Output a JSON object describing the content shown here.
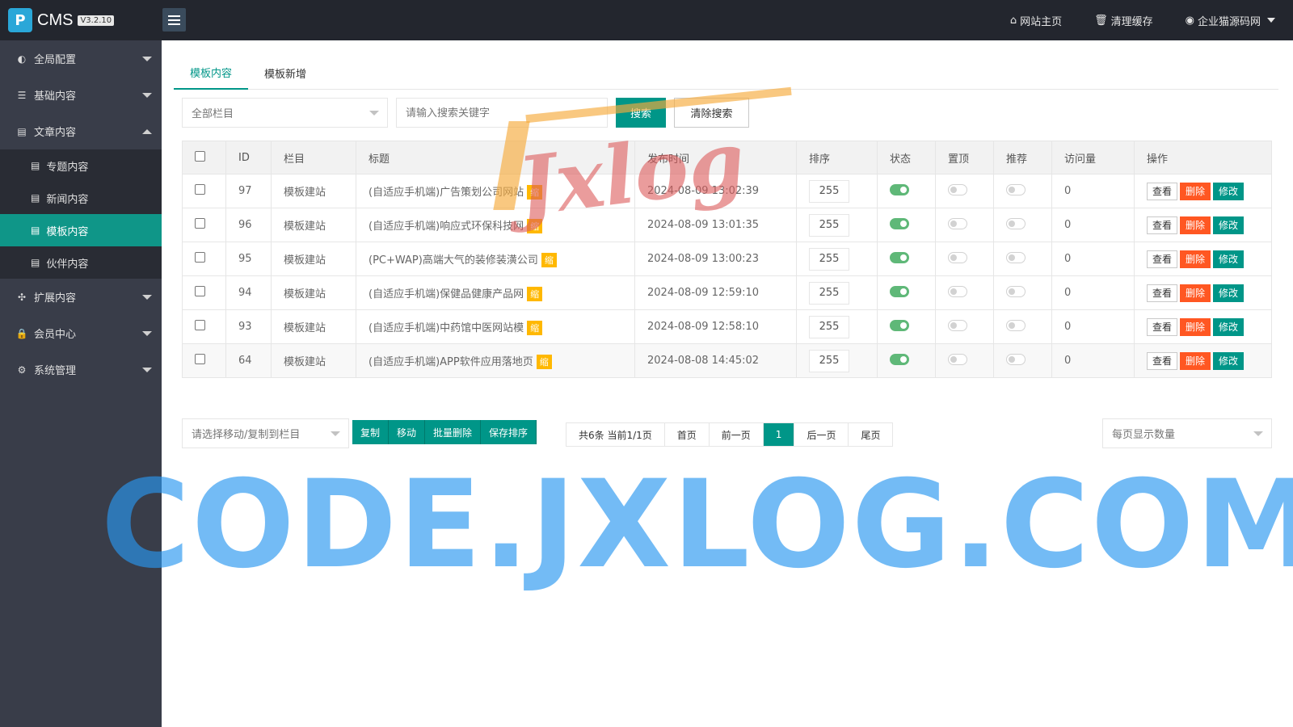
{
  "topbar": {
    "logo_mark": "P",
    "logo_text": "CMS",
    "version": "V3.2.10",
    "nav": [
      {
        "icon": "home-icon",
        "label": "网站主页"
      },
      {
        "icon": "trash-icon",
        "label": "清理缓存"
      },
      {
        "icon": "user-circle-icon",
        "label": "企业猫源码网"
      }
    ]
  },
  "sidebar": {
    "groups": [
      {
        "icon": "globe-icon",
        "label": "全局配置"
      },
      {
        "icon": "sliders-icon",
        "label": "基础内容"
      },
      {
        "icon": "document-icon",
        "label": "文章内容"
      },
      {
        "icon": "expand-icon",
        "label": "扩展内容"
      },
      {
        "icon": "lock-icon",
        "label": "会员中心"
      },
      {
        "icon": "gear-icon",
        "label": "系统管理"
      }
    ],
    "article_items": [
      {
        "label": "专题内容"
      },
      {
        "label": "新闻内容"
      },
      {
        "label": "模板内容"
      },
      {
        "label": "伙伴内容"
      }
    ]
  },
  "tabs": [
    {
      "label": "模板内容"
    },
    {
      "label": "模板新增"
    }
  ],
  "filter": {
    "category_select": "全部栏目",
    "search_placeholder": "请输入搜索关键字",
    "search_button": "搜索",
    "clear_button": "清除搜索"
  },
  "table": {
    "headers": [
      "ID",
      "栏目",
      "标题",
      "发布时间",
      "排序",
      "状态",
      "置顶",
      "推荐",
      "访问量",
      "操作"
    ],
    "badge": "缩",
    "actions": {
      "view": "查看",
      "delete": "删除",
      "edit": "修改"
    },
    "rows": [
      {
        "id": "97",
        "category": "模板建站",
        "title": "(自适应手机端)广告策划公司网站",
        "time": "2024-08-09 13:02:39",
        "sort": "255",
        "status": true,
        "top": false,
        "recommend": false,
        "visits": "0"
      },
      {
        "id": "96",
        "category": "模板建站",
        "title": "(自适应手机端)响应式环保科技网",
        "time": "2024-08-09 13:01:35",
        "sort": "255",
        "status": true,
        "top": false,
        "recommend": false,
        "visits": "0"
      },
      {
        "id": "95",
        "category": "模板建站",
        "title": "(PC+WAP)高端大气的装修装潢公司",
        "time": "2024-08-09 13:00:23",
        "sort": "255",
        "status": true,
        "top": false,
        "recommend": false,
        "visits": "0"
      },
      {
        "id": "94",
        "category": "模板建站",
        "title": "(自适应手机端)保健品健康产品网",
        "time": "2024-08-09 12:59:10",
        "sort": "255",
        "status": true,
        "top": false,
        "recommend": false,
        "visits": "0"
      },
      {
        "id": "93",
        "category": "模板建站",
        "title": "(自适应手机端)中药馆中医网站模",
        "time": "2024-08-09 12:58:10",
        "sort": "255",
        "status": true,
        "top": false,
        "recommend": false,
        "visits": "0"
      },
      {
        "id": "64",
        "category": "模板建站",
        "title": "(自适应手机端)APP软件应用落地页",
        "time": "2024-08-08 14:45:02",
        "sort": "255",
        "status": true,
        "top": false,
        "recommend": false,
        "visits": "0"
      }
    ]
  },
  "bulk": {
    "move_select": "请选择移动/复制到栏目",
    "buttons": [
      "复制",
      "移动",
      "批量删除",
      "保存排序"
    ],
    "page_size_select": "每页显示数量"
  },
  "pager": {
    "summary": "共6条 当前1/1页",
    "first": "首页",
    "prev": "前一页",
    "current": "1",
    "next": "后一页",
    "last": "尾页"
  },
  "watermark": {
    "logo": "Jxlog",
    "site": "CODE.JXLOG.COM"
  },
  "colors": {
    "accent": "#009688",
    "danger": "#ff5722",
    "badge": "#ffb800",
    "switch_on": "#5fb878",
    "sidebar_bg": "#393d49",
    "topbar_bg": "#23262e"
  }
}
